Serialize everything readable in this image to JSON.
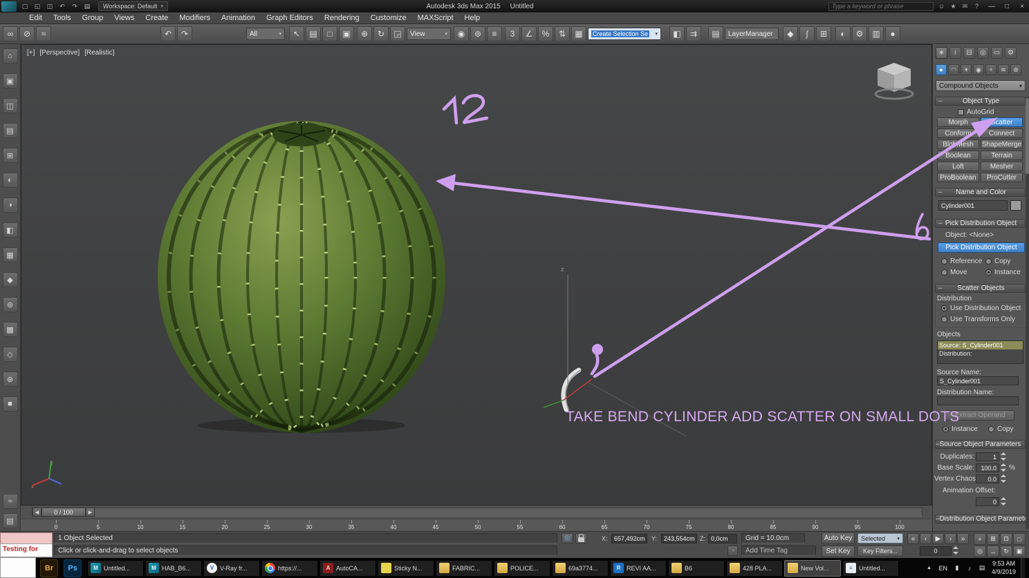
{
  "ui": {
    "dropdown_arrow": "▾"
  },
  "title_bar": {
    "qat_icons": [
      {
        "name": "new-scene-icon",
        "glyph": "▢"
      },
      {
        "name": "open-file-icon",
        "glyph": "◱"
      },
      {
        "name": "save-file-icon",
        "glyph": "◫"
      },
      {
        "name": "undo-icon",
        "glyph": "↶"
      },
      {
        "name": "redo-icon",
        "glyph": "↷"
      },
      {
        "name": "project-folder-icon",
        "glyph": "▤"
      }
    ],
    "workspace_label": "Workspace: Default",
    "app_title": "Autodesk 3ds Max  2015",
    "doc_title": "Untitled",
    "search_placeholder": "Type a keyword or phrase",
    "right_icons": [
      {
        "name": "sign-in-icon",
        "glyph": "☺"
      },
      {
        "name": "favorites-icon",
        "glyph": "★"
      },
      {
        "name": "mail-icon",
        "glyph": "✉"
      },
      {
        "name": "help-icon",
        "glyph": "?"
      }
    ],
    "window_controls": [
      {
        "name": "minimize-button",
        "glyph": "—"
      },
      {
        "name": "maximize-button",
        "glyph": "□"
      },
      {
        "name": "close-button",
        "glyph": "×"
      }
    ]
  },
  "menu_bar": {
    "items": [
      "Edit",
      "Tools",
      "Group",
      "Views",
      "Create",
      "Modifiers",
      "Animation",
      "Graph Editors",
      "Rendering",
      "Customize",
      "MAXScript",
      "Help"
    ]
  },
  "main_toolbar": {
    "link_icons": [
      {
        "name": "select-and-link-icon",
        "glyph": "∞"
      },
      {
        "name": "unlink-selection-icon",
        "glyph": "⊘"
      },
      {
        "name": "bind-to-space-warp-icon",
        "glyph": "≈"
      }
    ],
    "history_icons": [
      {
        "name": "undo-icon",
        "glyph": "↶"
      },
      {
        "name": "redo-icon",
        "glyph": "↷"
      }
    ],
    "filter_dropdown": "All",
    "selection_icons": [
      {
        "name": "select-object-icon",
        "glyph": "↖"
      },
      {
        "name": "select-by-name-icon",
        "glyph": "▤"
      },
      {
        "name": "selection-region-icon",
        "glyph": "□"
      },
      {
        "name": "window-crossing-icon",
        "glyph": "▣"
      }
    ],
    "transform_icons": [
      {
        "name": "select-and-move-icon",
        "glyph": "⊕"
      },
      {
        "name": "select-and-rotate-icon",
        "glyph": "↻"
      },
      {
        "name": "select-and-scale-icon",
        "glyph": "◲"
      }
    ],
    "coord_dropdown": "View",
    "pivot_icons": [
      {
        "name": "use-pivot-point-icon",
        "glyph": "◉"
      },
      {
        "name": "select-and-manipulate-icon",
        "glyph": "⊚"
      },
      {
        "name": "keyboard-override-icon",
        "glyph": "≡"
      }
    ],
    "snap_icons": [
      {
        "name": "snaps-toggle-icon",
        "glyph": "3"
      },
      {
        "name": "angle-snap-icon",
        "glyph": "∠"
      },
      {
        "name": "percent-snap-icon",
        "glyph": "%"
      },
      {
        "name": "spinner-snap-icon",
        "glyph": "⇅"
      }
    ],
    "sets_icons": [
      {
        "name": "edit-named-selection-sets-icon",
        "glyph": "▦"
      }
    ],
    "named_sets_value": "Create Selection Se",
    "mirror_align_icons": [
      {
        "name": "mirror-icon",
        "glyph": "◧"
      },
      {
        "name": "align-icon",
        "glyph": "⇉"
      }
    ],
    "layer_icons": [
      {
        "name": "layer-manager-icon",
        "glyph": "▤"
      }
    ],
    "layer_box": "LayerManager",
    "editor_icons": [
      {
        "name": "graphite-modeling-icon",
        "glyph": "◆"
      },
      {
        "name": "curve-editor-icon",
        "glyph": "ʃ"
      },
      {
        "name": "schematic-view-icon",
        "glyph": "⊞"
      }
    ],
    "render_icons": [
      {
        "name": "material-editor-icon",
        "glyph": "◐"
      },
      {
        "name": "render-setup-icon",
        "glyph": "⚙"
      },
      {
        "name": "rendered-frame-icon",
        "glyph": "▥"
      },
      {
        "name": "render-production-icon",
        "glyph": "●"
      }
    ]
  },
  "left_toolbar": {
    "icons": [
      {
        "name": "left-toolbar-icon-1",
        "glyph": "⌂"
      },
      {
        "name": "left-toolbar-icon-2",
        "glyph": "▣"
      },
      {
        "name": "left-toolbar-icon-3",
        "glyph": "◫"
      },
      {
        "name": "left-toolbar-icon-4",
        "glyph": "▤"
      },
      {
        "name": "left-toolbar-icon-5",
        "glyph": "⊞"
      },
      {
        "name": "left-toolbar-icon-6",
        "glyph": "◐"
      },
      {
        "name": "left-toolbar-icon-7",
        "glyph": "◑"
      },
      {
        "name": "left-toolbar-icon-8",
        "glyph": "◧"
      },
      {
        "name": "left-toolbar-icon-9",
        "glyph": "▦"
      },
      {
        "name": "left-toolbar-icon-10",
        "glyph": "◆"
      },
      {
        "name": "left-toolbar-icon-11",
        "glyph": "⊚"
      },
      {
        "name": "left-toolbar-icon-12",
        "glyph": "▩"
      },
      {
        "name": "left-toolbar-icon-13",
        "glyph": "◇"
      },
      {
        "name": "left-toolbar-icon-14",
        "glyph": "⊛"
      },
      {
        "name": "left-toolbar-icon-15",
        "glyph": "■"
      }
    ],
    "bottom_icons": [
      {
        "name": "mini-curve-editor-icon",
        "glyph": "≈"
      },
      {
        "name": "timeline-config-icon",
        "glyph": "▤"
      }
    ]
  },
  "viewport": {
    "label_plus": "[+]",
    "label_view": "[Perspective]",
    "label_shading": "[Realistic]",
    "annotation_number": "12",
    "annotation_text": "TAKE BEND CYLINDER ADD SCATTER ON SMALL DOTS",
    "z_axis_hint": "z",
    "axis_x": "x",
    "axis_y": "y"
  },
  "command_panel": {
    "rollout_minus": "–",
    "tabs": [
      {
        "name": "create-tab",
        "glyph": "∗",
        "active": true
      },
      {
        "name": "modify-tab",
        "glyph": "≀"
      },
      {
        "name": "hierarchy-tab",
        "glyph": "⊟"
      },
      {
        "name": "motion-tab",
        "glyph": "◎"
      },
      {
        "name": "display-tab",
        "glyph": "▭"
      },
      {
        "name": "utilities-tab",
        "glyph": "⚙"
      }
    ],
    "subtabs": [
      {
        "name": "geometry-button",
        "glyph": "●",
        "active": true
      },
      {
        "name": "shapes-button",
        "glyph": "◠"
      },
      {
        "name": "lights-button",
        "glyph": "☀"
      },
      {
        "name": "cameras-button",
        "glyph": "◉"
      },
      {
        "name": "helpers-button",
        "glyph": "+"
      },
      {
        "name": "spacewarps-button",
        "glyph": "≋"
      },
      {
        "name": "systems-button",
        "glyph": "⊛"
      }
    ],
    "category_dropdown": "Compound Objects",
    "object_type": {
      "title": "Object Type",
      "autogrid_label": "AutoGrid",
      "buttons": [
        {
          "label": "Morph"
        },
        {
          "label": "Scatter",
          "active": true
        },
        {
          "label": "Conform"
        },
        {
          "label": "Connect"
        },
        {
          "label": "BlobMesh"
        },
        {
          "label": "ShapeMerge"
        },
        {
          "label": "Boolean"
        },
        {
          "label": "Terrain"
        },
        {
          "label": "Loft"
        },
        {
          "label": "Mesher"
        },
        {
          "label": "ProBoolean"
        },
        {
          "label": "ProCutter"
        }
      ]
    },
    "name_color": {
      "title": "Name and Color",
      "name_value": "Cylinder001"
    },
    "pick_distribution": {
      "title": "Pick Distribution Object",
      "object_label": "Object:  <None>",
      "pick_button": "Pick Distribution Object",
      "radio_reference": "Reference",
      "radio_copy": "Copy",
      "radio_move": "Move",
      "radio_instance": "Instance"
    },
    "scatter_objects": {
      "title": "Scatter Objects",
      "distribution_label": "Distribution",
      "use_distribution": "Use Distribution Object",
      "use_transforms": "Use Transforms Only",
      "objects_label": "Objects",
      "list_line1": "Source: S_Cylinder001",
      "list_line2": "Distribution:",
      "source_name_label": "Source Name:",
      "source_name_value": "S_Cylinder001",
      "distribution_name_label": "Distribution Name:",
      "extract_button": "Extract Operand",
      "radio_instance": "Instance",
      "radio_copy": "Copy"
    },
    "source_params": {
      "title": "Source Object Parameters",
      "duplicates_label": "Duplicates:",
      "duplicates_value": "1",
      "base_scale_label": "Base Scale:",
      "base_scale_value": "100.0",
      "percent_suffix": "%",
      "vertex_chaos_label": "Vertex Chaos:",
      "vertex_chaos_value": "0.0",
      "animation_offset_label": "Animation Offset:",
      "animation_offset_value": "0"
    },
    "distribution_params": {
      "title": "Distribution Object Parameter"
    }
  },
  "timeline": {
    "slider_value": "0 / 100",
    "prev_glyph": "◀",
    "next_glyph": "▶",
    "ticks": [
      "0",
      "5",
      "10",
      "15",
      "20",
      "25",
      "30",
      "35",
      "40",
      "45",
      "50",
      "55",
      "60",
      "65",
      "70",
      "75",
      "80",
      "85",
      "90",
      "95",
      "100"
    ]
  },
  "status_bar": {
    "selection_status": "1 Object Selected",
    "prompt": "Click or click-and-drag to select objects",
    "isolate_glyph": "◎",
    "x_label": "X:",
    "x_value": "657,492cm",
    "y_label": "Y:",
    "y_value": "243,554cm",
    "z_label": "Z:",
    "z_value": "0,0cm",
    "grid_value": "Grid = 10.0cm",
    "time_tag_value": "Add Time Tag",
    "auto_key_label": "Auto Key",
    "set_key_label": "Set Key",
    "selection_set_value": "Selected",
    "key_filters_label": "Key Filters...",
    "frame_value": "0",
    "playback_icons": [
      {
        "name": "go-to-start-icon",
        "glyph": "«"
      },
      {
        "name": "previous-frame-icon",
        "glyph": "‹"
      },
      {
        "name": "play-icon",
        "glyph": "▶"
      },
      {
        "name": "next-frame-icon",
        "glyph": "›"
      },
      {
        "name": "go-to-end-icon",
        "glyph": "»"
      }
    ],
    "nav_icons": [
      {
        "name": "zoom-icon",
        "glyph": "+"
      },
      {
        "name": "zoom-all-icon",
        "glyph": "⊞"
      },
      {
        "name": "zoom-extents-icon",
        "glyph": "⊡"
      },
      {
        "name": "zoom-region-icon",
        "glyph": "□"
      },
      {
        "name": "field-of-view-icon",
        "glyph": "◎"
      },
      {
        "name": "pan-icon",
        "glyph": "↔"
      },
      {
        "name": "orbit-icon",
        "glyph": "↻"
      },
      {
        "name": "maximize-viewport-icon",
        "glyph": "▣"
      }
    ]
  },
  "overlay_note": {
    "text": "Testing for"
  },
  "taskbar": {
    "pinned": [
      {
        "name": "bridge-icon",
        "label": "Br",
        "type": "bridge"
      },
      {
        "name": "photoshop-icon",
        "label": "Ps",
        "type": "ps"
      }
    ],
    "items": [
      {
        "label": "Untitled...",
        "type": "max"
      },
      {
        "label": "HAB_B6...",
        "type": "max"
      },
      {
        "label": "V-Ray fr...",
        "type": "vray"
      },
      {
        "label": "https://...",
        "type": "chrome"
      },
      {
        "label": "AutoCA...",
        "type": "acad"
      },
      {
        "label": "Sticky N...",
        "type": "sticky"
      },
      {
        "label": "FABRIC...",
        "type": "folder"
      },
      {
        "label": "POLICE...",
        "type": "folder"
      },
      {
        "label": "69a3774...",
        "type": "folder"
      },
      {
        "label": "REVI AA...",
        "type": "revit"
      },
      {
        "label": "B6",
        "type": "folder"
      },
      {
        "label": "428 PLA...",
        "type": "folder"
      },
      {
        "label": "New Vol...",
        "type": "folder",
        "active": true
      },
      {
        "label": "Untitled...",
        "type": "notepad"
      }
    ],
    "tray": {
      "expand_glyph": "▲",
      "language": "EN",
      "icons": [
        {
          "name": "battery-icon",
          "glyph": "▮"
        },
        {
          "name": "volume-icon",
          "glyph": "♪"
        },
        {
          "name": "network-icon",
          "glyph": "▤"
        }
      ],
      "time": "9:53 AM",
      "date": "4/9/2019"
    }
  }
}
